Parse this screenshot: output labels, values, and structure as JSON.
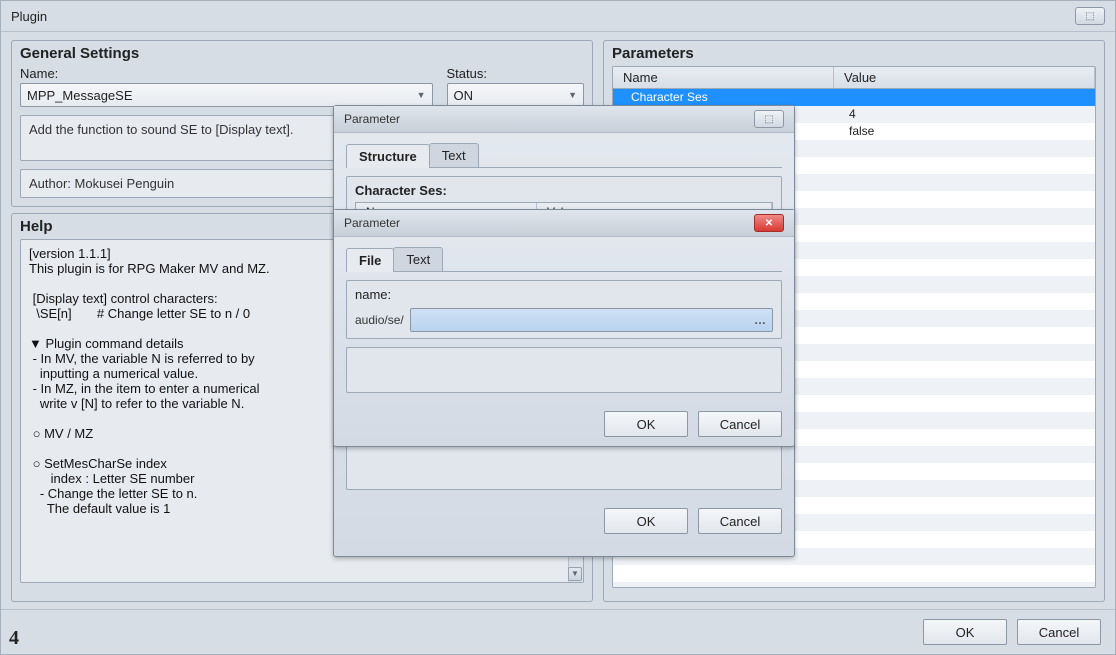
{
  "window": {
    "title": "Plugin",
    "close_glyph": "⬚"
  },
  "general": {
    "group_title": "General Settings",
    "name_label": "Name:",
    "name_value": "MPP_MessageSE",
    "status_label": "Status:",
    "status_value": "ON",
    "description": "Add the function to sound SE to [Display text].",
    "author": "Author: Mokusei Penguin"
  },
  "help": {
    "group_title": "Help",
    "text": "[version 1.1.1]\nThis plugin is for RPG Maker MV and MZ.\n\n [Display text] control characters:\n  \\SE[n]       # Change letter SE to n / 0\n\n▼ Plugin command details\n - In MV, the variable N is referred to by\n   inputting a numerical value.\n - In MZ, in the item to enter a numerical\n   write v [N] to refer to the variable N.\n\n ○ MV / MZ\n\n ○ SetMesCharSe index\n      index : Letter SE number\n   - Change the letter SE to n.\n     The default value is 1"
  },
  "parameters": {
    "group_title": "Parameters",
    "head_name": "Name",
    "head_value": "Value",
    "rows": [
      {
        "name": "Character Ses",
        "value": ""
      },
      {
        "name": "",
        "value": "4"
      },
      {
        "name": "",
        "value": "false"
      }
    ]
  },
  "buttons": {
    "ok": "OK",
    "cancel": "Cancel"
  },
  "corner": "4",
  "modal1": {
    "title": "Parameter",
    "tab_structure": "Structure",
    "tab_text": "Text",
    "section_label": "Character Ses:",
    "col_name": "Name",
    "col_value": "Value"
  },
  "modal2": {
    "title": "Parameter",
    "tab_file": "File",
    "tab_text": "Text",
    "name_label": "name:",
    "path_prefix": "audio/se/",
    "path_value": ""
  }
}
